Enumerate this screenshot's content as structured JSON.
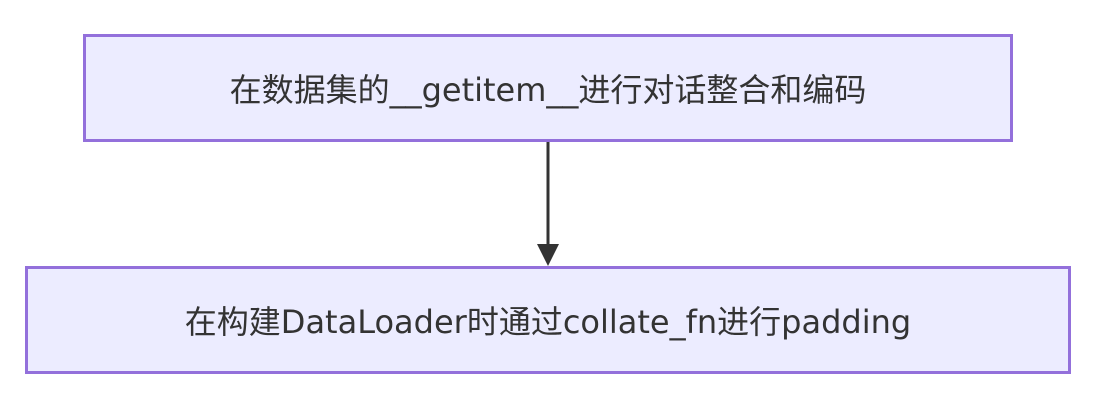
{
  "nodes": {
    "top": {
      "label": "在数据集的__getitem__进行对话整合和编码"
    },
    "bottom": {
      "label": "在构建DataLoader时通过collate_fn进行padding"
    }
  },
  "colors": {
    "node_fill": "#ECECFF",
    "node_border": "#9370DB",
    "text": "#333333",
    "edge": "#333333"
  }
}
